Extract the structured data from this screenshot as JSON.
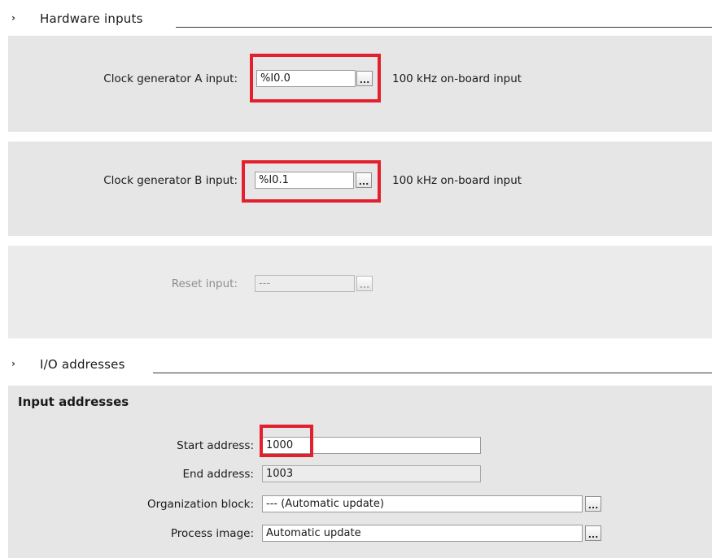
{
  "hardware_inputs": {
    "title": "Hardware inputs",
    "clock_a": {
      "label": "Clock generator A input:",
      "value": "%I0.0",
      "note": "100 kHz on-board input"
    },
    "clock_b": {
      "label": "Clock generator B input:",
      "value": "%I0.1",
      "note": "100 kHz on-board input"
    },
    "reset": {
      "label": "Reset input:",
      "value": "---"
    }
  },
  "io_addresses": {
    "title": "I/O addresses",
    "input_addresses": {
      "title": "Input addresses",
      "start_address": {
        "label": "Start address:",
        "value": "1000"
      },
      "end_address": {
        "label": "End address:",
        "value": "1003"
      },
      "organization_block": {
        "label": "Organization block:",
        "value": "--- (Automatic update)"
      },
      "process_image": {
        "label": "Process image:",
        "value": "Automatic update"
      }
    }
  },
  "browse_button_label": "...",
  "chevron": "›",
  "colors": {
    "highlight": "#e3202e",
    "panel": "#e6e6e6"
  }
}
